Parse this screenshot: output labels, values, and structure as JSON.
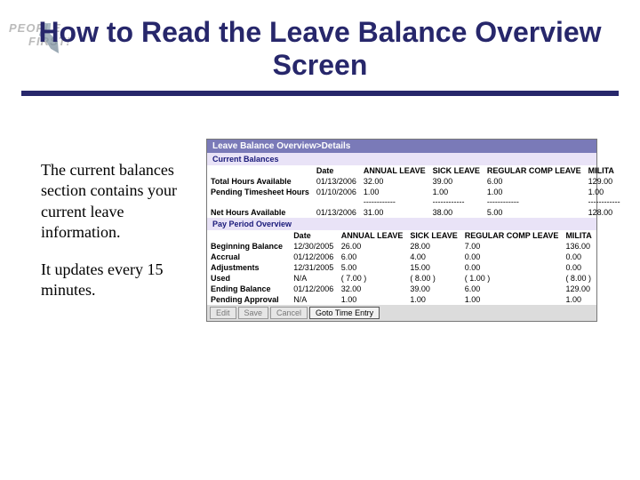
{
  "logo": {
    "line1": "PEOPLE",
    "line2": "FIRST!"
  },
  "title": "How to Read the Leave Balance Overview Screen",
  "body": {
    "p1": "The current balances section contains your current leave information.",
    "p2": "It updates every 15 minutes."
  },
  "screenshot": {
    "titlebar": "Leave Balance Overview>Details",
    "section1": {
      "header": "Current Balances",
      "cols": [
        "",
        "Date",
        "ANNUAL LEAVE",
        "SICK LEAVE",
        "REGULAR COMP LEAVE",
        "MILITA"
      ],
      "rows": [
        {
          "label": "Total Hours Available",
          "date": "01/13/2006",
          "c1": "32.00",
          "c2": "39.00",
          "c3": "6.00",
          "c4": "129.00"
        },
        {
          "label": "Pending Timesheet Hours",
          "date": "01/10/2006",
          "c1": "1.00",
          "c2": "1.00",
          "c3": "1.00",
          "c4": "1.00"
        }
      ],
      "net": {
        "label": "Net Hours Available",
        "date": "01/13/2006",
        "c1": "31.00",
        "c2": "38.00",
        "c3": "5.00",
        "c4": "128.00"
      }
    },
    "section2": {
      "header": "Pay Period Overview",
      "cols": [
        "",
        "Date",
        "ANNUAL LEAVE",
        "SICK LEAVE",
        "REGULAR COMP LEAVE",
        "MILITA"
      ],
      "rows": [
        {
          "label": "Beginning Balance",
          "date": "12/30/2005",
          "c1": "26.00",
          "c2": "28.00",
          "c3": "7.00",
          "c4": "136.00"
        },
        {
          "label": "Accrual",
          "date": "01/12/2006",
          "c1": "6.00",
          "c2": "4.00",
          "c3": "0.00",
          "c4": "0.00"
        },
        {
          "label": "Adjustments",
          "date": "12/31/2005",
          "c1": "5.00",
          "c2": "15.00",
          "c3": "0.00",
          "c4": "0.00"
        },
        {
          "label": "Used",
          "date": "N/A",
          "c1": "( 7.00 )",
          "c2": "( 8.00 )",
          "c3": "( 1.00 )",
          "c4": "( 8.00 )"
        },
        {
          "label": "Ending Balance",
          "date": "01/12/2006",
          "c1": "32.00",
          "c2": "39.00",
          "c3": "6.00",
          "c4": "129.00"
        },
        {
          "label": "Pending Approval",
          "date": "N/A",
          "c1": "1.00",
          "c2": "1.00",
          "c3": "1.00",
          "c4": "1.00"
        }
      ]
    },
    "buttons": {
      "edit": "Edit",
      "save": "Save",
      "cancel": "Cancel",
      "goto": "Goto Time Entry"
    },
    "dashes": "------------"
  }
}
